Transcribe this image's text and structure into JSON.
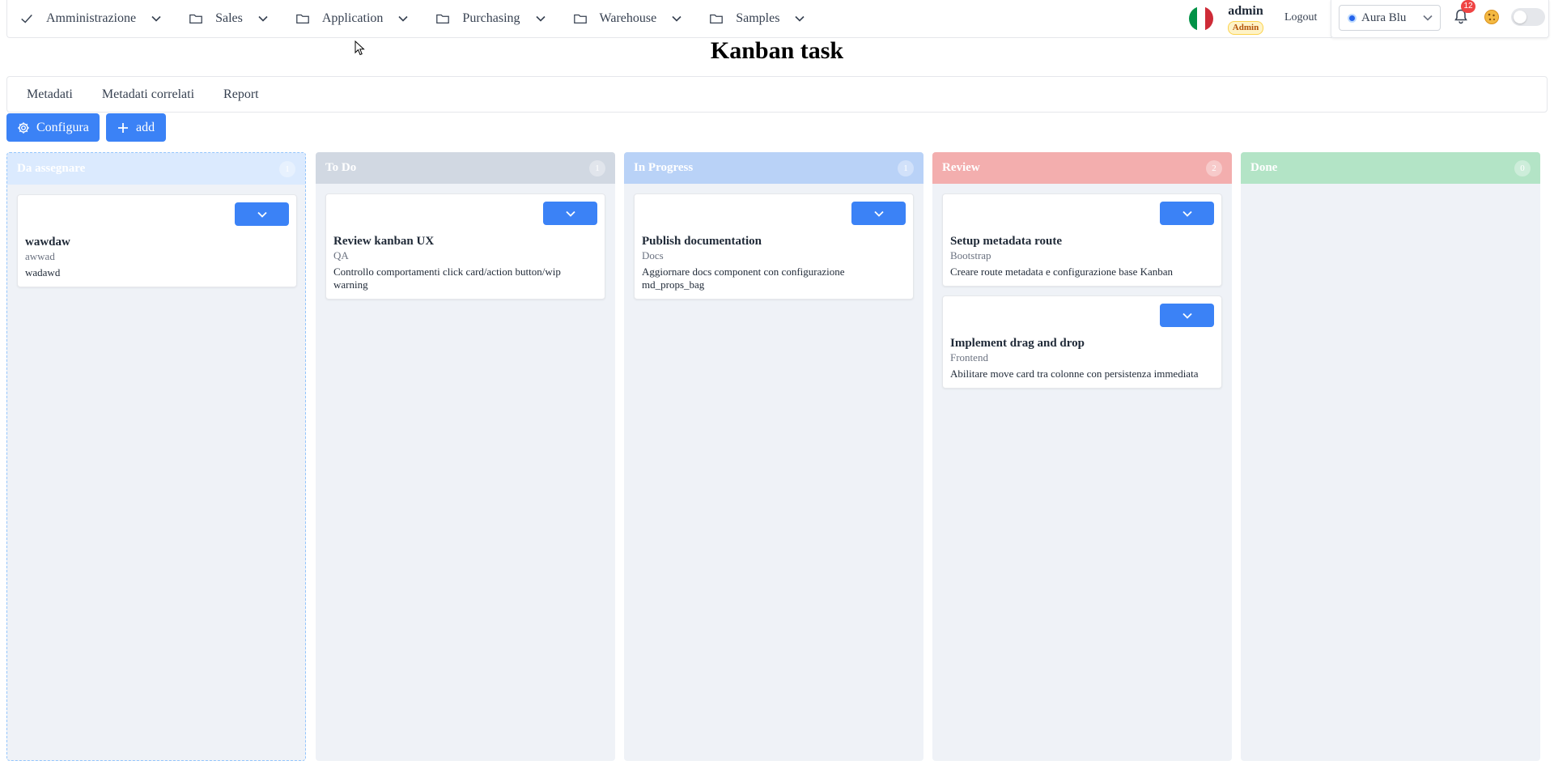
{
  "nav": {
    "items": [
      {
        "label": "Amministrazione",
        "icon": "check-icon"
      },
      {
        "label": "Sales",
        "icon": "folder-icon"
      },
      {
        "label": "Application",
        "icon": "folder-icon"
      },
      {
        "label": "Purchasing",
        "icon": "folder-icon"
      },
      {
        "label": "Warehouse",
        "icon": "folder-icon"
      },
      {
        "label": "Samples",
        "icon": "folder-icon"
      }
    ],
    "language_flag": "italy-flag-icon",
    "user": {
      "name": "admin",
      "role": "Admin"
    },
    "logout_label": "Logout",
    "theme": {
      "selected": "Aura Blue",
      "accent": "#2563eb"
    },
    "notifications": {
      "count": "12"
    }
  },
  "page": {
    "title": "Kanban task"
  },
  "tabs": [
    {
      "label": "Metadati"
    },
    {
      "label": "Metadati correlati"
    },
    {
      "label": "Report"
    }
  ],
  "toolbar": {
    "configure_label": "Configura",
    "add_label": "add"
  },
  "board": {
    "columns": [
      {
        "title": "Da assegnare",
        "count": "1",
        "color": "#dbeafe",
        "cards": [
          {
            "title": "wawdaw",
            "tag": "awwad",
            "description": "wadawd"
          }
        ]
      },
      {
        "title": "To Do",
        "count": "1",
        "color": "#d1d8e2",
        "cards": [
          {
            "title": "Review kanban UX",
            "tag": "QA",
            "description": "Controllo comportamenti click card/action button/wip warning"
          }
        ]
      },
      {
        "title": "In Progress",
        "count": "1",
        "color": "#b9d2f7",
        "cards": [
          {
            "title": "Publish documentation",
            "tag": "Docs",
            "description": "Aggiornare docs component con configurazione md_props_bag"
          }
        ]
      },
      {
        "title": "Review",
        "count": "2",
        "color": "#f3aeae",
        "cards": [
          {
            "title": "Setup metadata route",
            "tag": "Bootstrap",
            "description": "Creare route metadata e configurazione base Kanban"
          },
          {
            "title": "Implement drag and drop",
            "tag": "Frontend",
            "description": "Abilitare move card tra colonne con persistenza immediata"
          }
        ]
      },
      {
        "title": "Done",
        "count": "0",
        "color": "#b3e4c6",
        "cards": []
      }
    ],
    "card_action_color": "#3b82f6"
  }
}
